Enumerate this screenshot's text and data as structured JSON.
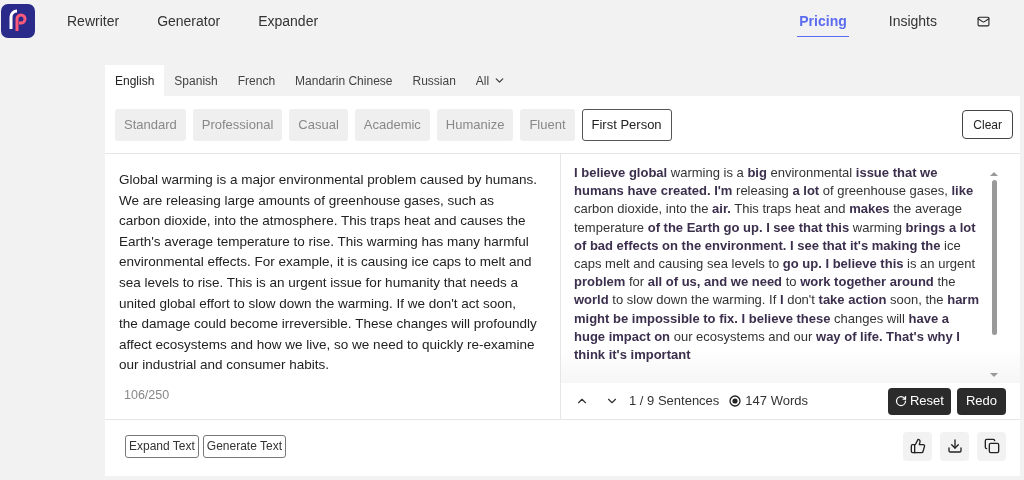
{
  "nav": {
    "items": [
      {
        "label": "Rewriter"
      },
      {
        "label": "Generator"
      },
      {
        "label": "Expander"
      }
    ],
    "right_items": [
      {
        "label": "Pricing",
        "selected": true
      },
      {
        "label": "Insights",
        "selected": false
      }
    ]
  },
  "languages": [
    {
      "label": "English",
      "selected": true
    },
    {
      "label": "Spanish",
      "selected": false
    },
    {
      "label": "French",
      "selected": false
    },
    {
      "label": "Mandarin Chinese",
      "selected": false
    },
    {
      "label": "Russian",
      "selected": false
    },
    {
      "label": "All",
      "selected": false
    }
  ],
  "modes": [
    {
      "label": "Standard",
      "selected": false
    },
    {
      "label": "Professional",
      "selected": false
    },
    {
      "label": "Casual",
      "selected": false
    },
    {
      "label": "Academic",
      "selected": false
    },
    {
      "label": "Humanize",
      "selected": false
    },
    {
      "label": "Fluent",
      "selected": false
    },
    {
      "label": "First Person",
      "selected": true
    }
  ],
  "clear_button": "Clear",
  "input": {
    "text": "Global warming is a major environmental problem caused by humans. We are releasing large amounts of greenhouse gases, such as carbon dioxide, into the atmosphere. This traps heat and causes the Earth's average temperature to rise. This warming has many harmful environmental effects. For example, it is causing ice caps to melt and sea levels to rise. This is an urgent issue for humanity that needs a united global effort to slow down the warming. If we don't act soon, the damage could become irreversible. These changes will profoundly affect ecosystems and how we live, so we need to quickly re-examine our industrial and consumer habits.",
    "count": "106/250"
  },
  "output": {
    "text": "**I believe global** warming is a **big** environmental **issue that we humans have created. I'm** releasing **a lot** of greenhouse gases, **like** carbon dioxide, into the **air.** This traps heat and **makes** the average temperature **of the Earth go up. I see that this** warming **brings a lot of bad effects on the environment. I see that it's making the** ice caps melt and causing sea levels to **go up. I believe this** is an urgent **problem** for **all of us, and we need** to **work together around** the **world** to slow down the warming. If **I** don't **take action** soon, the **harm might be impossible to fix. I believe these** changes will **have a huge impact on** our ecosystems and our **way of life. That's why I think it's important**",
    "sentences": "1 / 9 Sentences",
    "words": "147 Words",
    "reset": "Reset",
    "redo": "Redo"
  },
  "footer_buttons": [
    "Expand Text",
    "Generate Text"
  ]
}
